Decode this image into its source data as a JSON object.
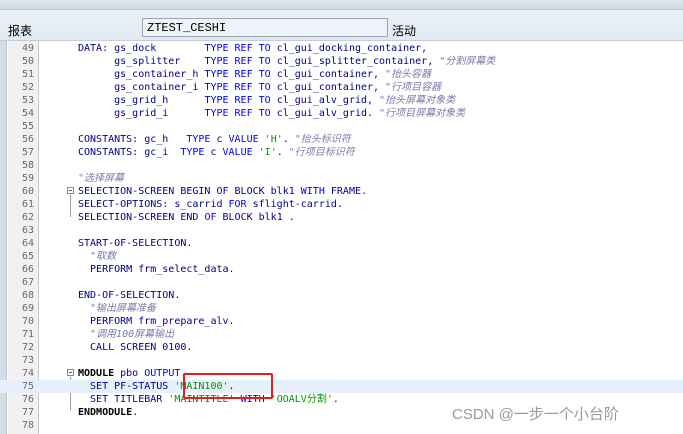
{
  "toolbar": {
    "report_label": "报表",
    "program_name": "ZTEST_CESHI",
    "status_label": "活动"
  },
  "code_lines": [
    {
      "n": "49",
      "tokens": [
        [
          "plain",
          "DATA: gs_dock        "
        ],
        [
          "kw",
          "TYPE REF TO"
        ],
        [
          "plain",
          " cl_gui_docking_container,"
        ]
      ]
    },
    {
      "n": "50",
      "tokens": [
        [
          "plain",
          "      gs_splitter    "
        ],
        [
          "kw",
          "TYPE REF TO"
        ],
        [
          "plain",
          " cl_gui_splitter_container, "
        ],
        [
          "cmt",
          "\"分割屏幕类"
        ]
      ]
    },
    {
      "n": "51",
      "tokens": [
        [
          "plain",
          "      gs_container_h "
        ],
        [
          "kw",
          "TYPE REF TO"
        ],
        [
          "plain",
          " cl_gui_container, "
        ],
        [
          "cmt",
          "\"抬头容器"
        ]
      ]
    },
    {
      "n": "52",
      "tokens": [
        [
          "plain",
          "      gs_container_i "
        ],
        [
          "kw",
          "TYPE REF TO"
        ],
        [
          "plain",
          " cl_gui_container, "
        ],
        [
          "cmt",
          "\"行项目容器"
        ]
      ]
    },
    {
      "n": "53",
      "tokens": [
        [
          "plain",
          "      gs_grid_h      "
        ],
        [
          "kw",
          "TYPE REF TO"
        ],
        [
          "plain",
          " cl_gui_alv_grid, "
        ],
        [
          "cmt",
          "\"抬头屏幕对象类"
        ]
      ]
    },
    {
      "n": "54",
      "tokens": [
        [
          "plain",
          "      gs_grid_i      "
        ],
        [
          "kw",
          "TYPE REF TO"
        ],
        [
          "plain",
          " cl_gui_alv_grid. "
        ],
        [
          "cmt",
          "\"行项目屏幕对象类"
        ]
      ]
    },
    {
      "n": "55",
      "tokens": []
    },
    {
      "n": "56",
      "tokens": [
        [
          "plain",
          "CONSTANTS: gc_h   "
        ],
        [
          "kw",
          "TYPE"
        ],
        [
          "plain",
          " c "
        ],
        [
          "kw",
          "VALUE"
        ],
        [
          "plain",
          " "
        ],
        [
          "str",
          "'H'"
        ],
        [
          "plain",
          ". "
        ],
        [
          "cmt",
          "\"抬头标识符"
        ]
      ]
    },
    {
      "n": "57",
      "tokens": [
        [
          "plain",
          "CONSTANTS: gc_i  "
        ],
        [
          "kw",
          "TYPE"
        ],
        [
          "plain",
          " c "
        ],
        [
          "kw",
          "VALUE"
        ],
        [
          "plain",
          " "
        ],
        [
          "str",
          "'I'"
        ],
        [
          "plain",
          ". "
        ],
        [
          "cmt",
          "\"行项目标识符"
        ]
      ]
    },
    {
      "n": "58",
      "tokens": []
    },
    {
      "n": "59",
      "tokens": [
        [
          "cmt",
          "\"选择屏幕"
        ]
      ]
    },
    {
      "n": "60",
      "fold": true,
      "tokens": [
        [
          "plain",
          "SELECTION-SCREEN BEGIN OF BLOCK blk1 "
        ],
        [
          "kw",
          "WITH"
        ],
        [
          "plain",
          " FRAME."
        ]
      ]
    },
    {
      "n": "61",
      "tokens": [
        [
          "plain",
          "SELECT-OPTIONS: s_carrid "
        ],
        [
          "kw",
          "FOR"
        ],
        [
          "plain",
          " sflight-carrid."
        ]
      ]
    },
    {
      "n": "62",
      "tokens": [
        [
          "plain",
          "SELECTION-SCREEN END "
        ],
        [
          "kw",
          "OF"
        ],
        [
          "plain",
          " BLOCK blk1 ."
        ]
      ]
    },
    {
      "n": "63",
      "tokens": []
    },
    {
      "n": "64",
      "tokens": [
        [
          "plain",
          "START-OF-SELECTION."
        ]
      ]
    },
    {
      "n": "65",
      "tokens": [
        [
          "cmt",
          "  \"取数"
        ]
      ]
    },
    {
      "n": "66",
      "tokens": [
        [
          "plain",
          "  PERFORM frm_select_data."
        ]
      ]
    },
    {
      "n": "67",
      "tokens": []
    },
    {
      "n": "68",
      "tokens": [
        [
          "plain",
          "END-OF-SELECTION."
        ]
      ]
    },
    {
      "n": "69",
      "tokens": [
        [
          "cmt",
          "  \"输出屏幕准备"
        ]
      ]
    },
    {
      "n": "70",
      "tokens": [
        [
          "plain",
          "  PERFORM frm_prepare_alv."
        ]
      ]
    },
    {
      "n": "71",
      "tokens": [
        [
          "cmt",
          "  \"调用100屏幕输出"
        ]
      ]
    },
    {
      "n": "72",
      "tokens": [
        [
          "plain",
          "  CALL SCREEN 0100."
        ]
      ]
    },
    {
      "n": "73",
      "tokens": []
    },
    {
      "n": "74",
      "fold": true,
      "tokens": [
        [
          "bold",
          "MODULE"
        ],
        [
          "plain",
          " pbo "
        ],
        [
          "kw",
          "OUTPUT"
        ],
        [
          "plain",
          "."
        ]
      ]
    },
    {
      "n": "75",
      "hl": true,
      "tokens": [
        [
          "plain",
          "  SET PF-STATUS "
        ],
        [
          "str",
          "'MAIN100'"
        ],
        [
          "plain",
          "."
        ]
      ]
    },
    {
      "n": "76",
      "tokens": [
        [
          "plain",
          "  SET TITLEBAR "
        ],
        [
          "str",
          "'MAINTITLE'"
        ],
        [
          "plain",
          " "
        ],
        [
          "kw",
          "WITH"
        ],
        [
          "plain",
          " "
        ],
        [
          "str",
          "'OOALV分割'"
        ],
        [
          "plain",
          "."
        ]
      ]
    },
    {
      "n": "77",
      "tokens": [
        [
          "bold",
          "ENDMODULE"
        ],
        [
          "plain",
          "."
        ]
      ]
    },
    {
      "n": "78",
      "tokens": []
    }
  ],
  "watermark": "CSDN @一步一个小台阶"
}
